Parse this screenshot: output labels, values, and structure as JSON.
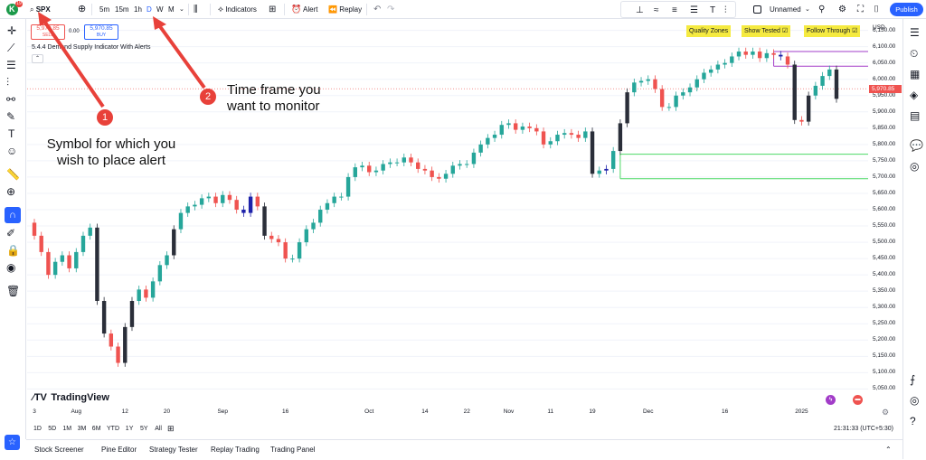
{
  "header": {
    "logo_badge": "19",
    "symbol": "SPX",
    "timeframes": [
      "5m",
      "15m",
      "1h",
      "D",
      "W",
      "M"
    ],
    "active_timeframe": "D",
    "indicators_label": "Indicators",
    "alert_label": "Alert",
    "replay_label": "Replay",
    "layout_name": "Unnamed",
    "publish_label": "Publish"
  },
  "trade": {
    "sell_price": "5,970.85",
    "sell_label": "SELL",
    "spread": "0.00",
    "buy_price": "5,970.85",
    "buy_label": "BUY"
  },
  "indicator": {
    "name": "5.4.4 Demand Supply Indicator With Alerts",
    "toggles": [
      "Quality Zones",
      "Show Tested ☑",
      "Follow Through ☑"
    ]
  },
  "price_scale": {
    "currency": "USD",
    "labels": [
      "6,150.00",
      "6,100.00",
      "6,050.00",
      "6,000.00",
      "5,950.00",
      "5,900.00",
      "5,850.00",
      "5,800.00",
      "5,750.00",
      "5,700.00",
      "5,650.00",
      "5,600.00",
      "5,550.00",
      "5,500.00",
      "5,450.00",
      "5,400.00",
      "5,350.00",
      "5,300.00",
      "5,250.00",
      "5,200.00",
      "5,150.00",
      "5,100.00",
      "5,050.00"
    ],
    "last_price": "5,970.85"
  },
  "time_axis": {
    "labels": [
      "3",
      "Aug",
      "12",
      "20",
      "Sep",
      "16",
      "Oct",
      "14",
      "22",
      "Nov",
      "11",
      "19",
      "Dec",
      "16",
      "2025"
    ]
  },
  "ranges": [
    "1D",
    "5D",
    "1M",
    "3M",
    "6M",
    "YTD",
    "1Y",
    "5Y",
    "All"
  ],
  "clock": "21:31:33 (UTC+5:30)",
  "bottom_tabs": [
    "Stock Screener",
    "Pine Editor",
    "Strategy Tester",
    "Replay Trading",
    "Trading Panel"
  ],
  "watermark": "TradingView",
  "annotations": {
    "one_number": "1",
    "one_text": "Symbol for which you wish to place alert",
    "two_number": "2",
    "two_text": "Time frame you want to monitor"
  },
  "colors": {
    "up": "#26a69a",
    "down": "#ef5350",
    "dark": "#2a2e39",
    "marker": "#1e22aa",
    "accent": "#2962ff",
    "arrow": "#e8413a",
    "zone_green": "#4cd964",
    "zone_purple": "#a23cc8"
  },
  "chart_data": {
    "type": "candlestick",
    "ylim": [
      5040,
      6160
    ],
    "last_price": 5970.85,
    "zones": [
      {
        "type": "demand",
        "top": 5770,
        "bottom": 5695
      },
      {
        "type": "supply",
        "top": 6085,
        "bottom": 6040
      }
    ],
    "closes": [
      5520,
      5470,
      5400,
      5440,
      5460,
      5420,
      5470,
      5520,
      5545,
      5320,
      5220,
      5180,
      5130,
      5240,
      5320,
      5355,
      5330,
      5380,
      5430,
      5460,
      5540,
      5590,
      5610,
      5615,
      5635,
      5640,
      5620,
      5645,
      5630,
      5600,
      5590,
      5640,
      5610,
      5520,
      5510,
      5500,
      5450,
      5450,
      5500,
      5540,
      5560,
      5600,
      5620,
      5640,
      5640,
      5700,
      5730,
      5735,
      5715,
      5720,
      5740,
      5745,
      5745,
      5760,
      5745,
      5725,
      5720,
      5700,
      5695,
      5710,
      5735,
      5740,
      5740,
      5775,
      5800,
      5820,
      5830,
      5860,
      5865,
      5845,
      5855,
      5850,
      5840,
      5800,
      5810,
      5830,
      5835,
      5830,
      5820,
      5840,
      5710,
      5720,
      5725,
      5780,
      5865,
      5960,
      5990,
      5995,
      6000,
      5970,
      5915,
      5915,
      5950,
      5960,
      5975,
      6000,
      6020,
      6030,
      6045,
      6050,
      6070,
      6085,
      6075,
      6085,
      6065,
      6080,
      6075,
      6070,
      6045,
      5875,
      5870,
      5950,
      5980,
      6010,
      6030,
      5940
    ]
  }
}
